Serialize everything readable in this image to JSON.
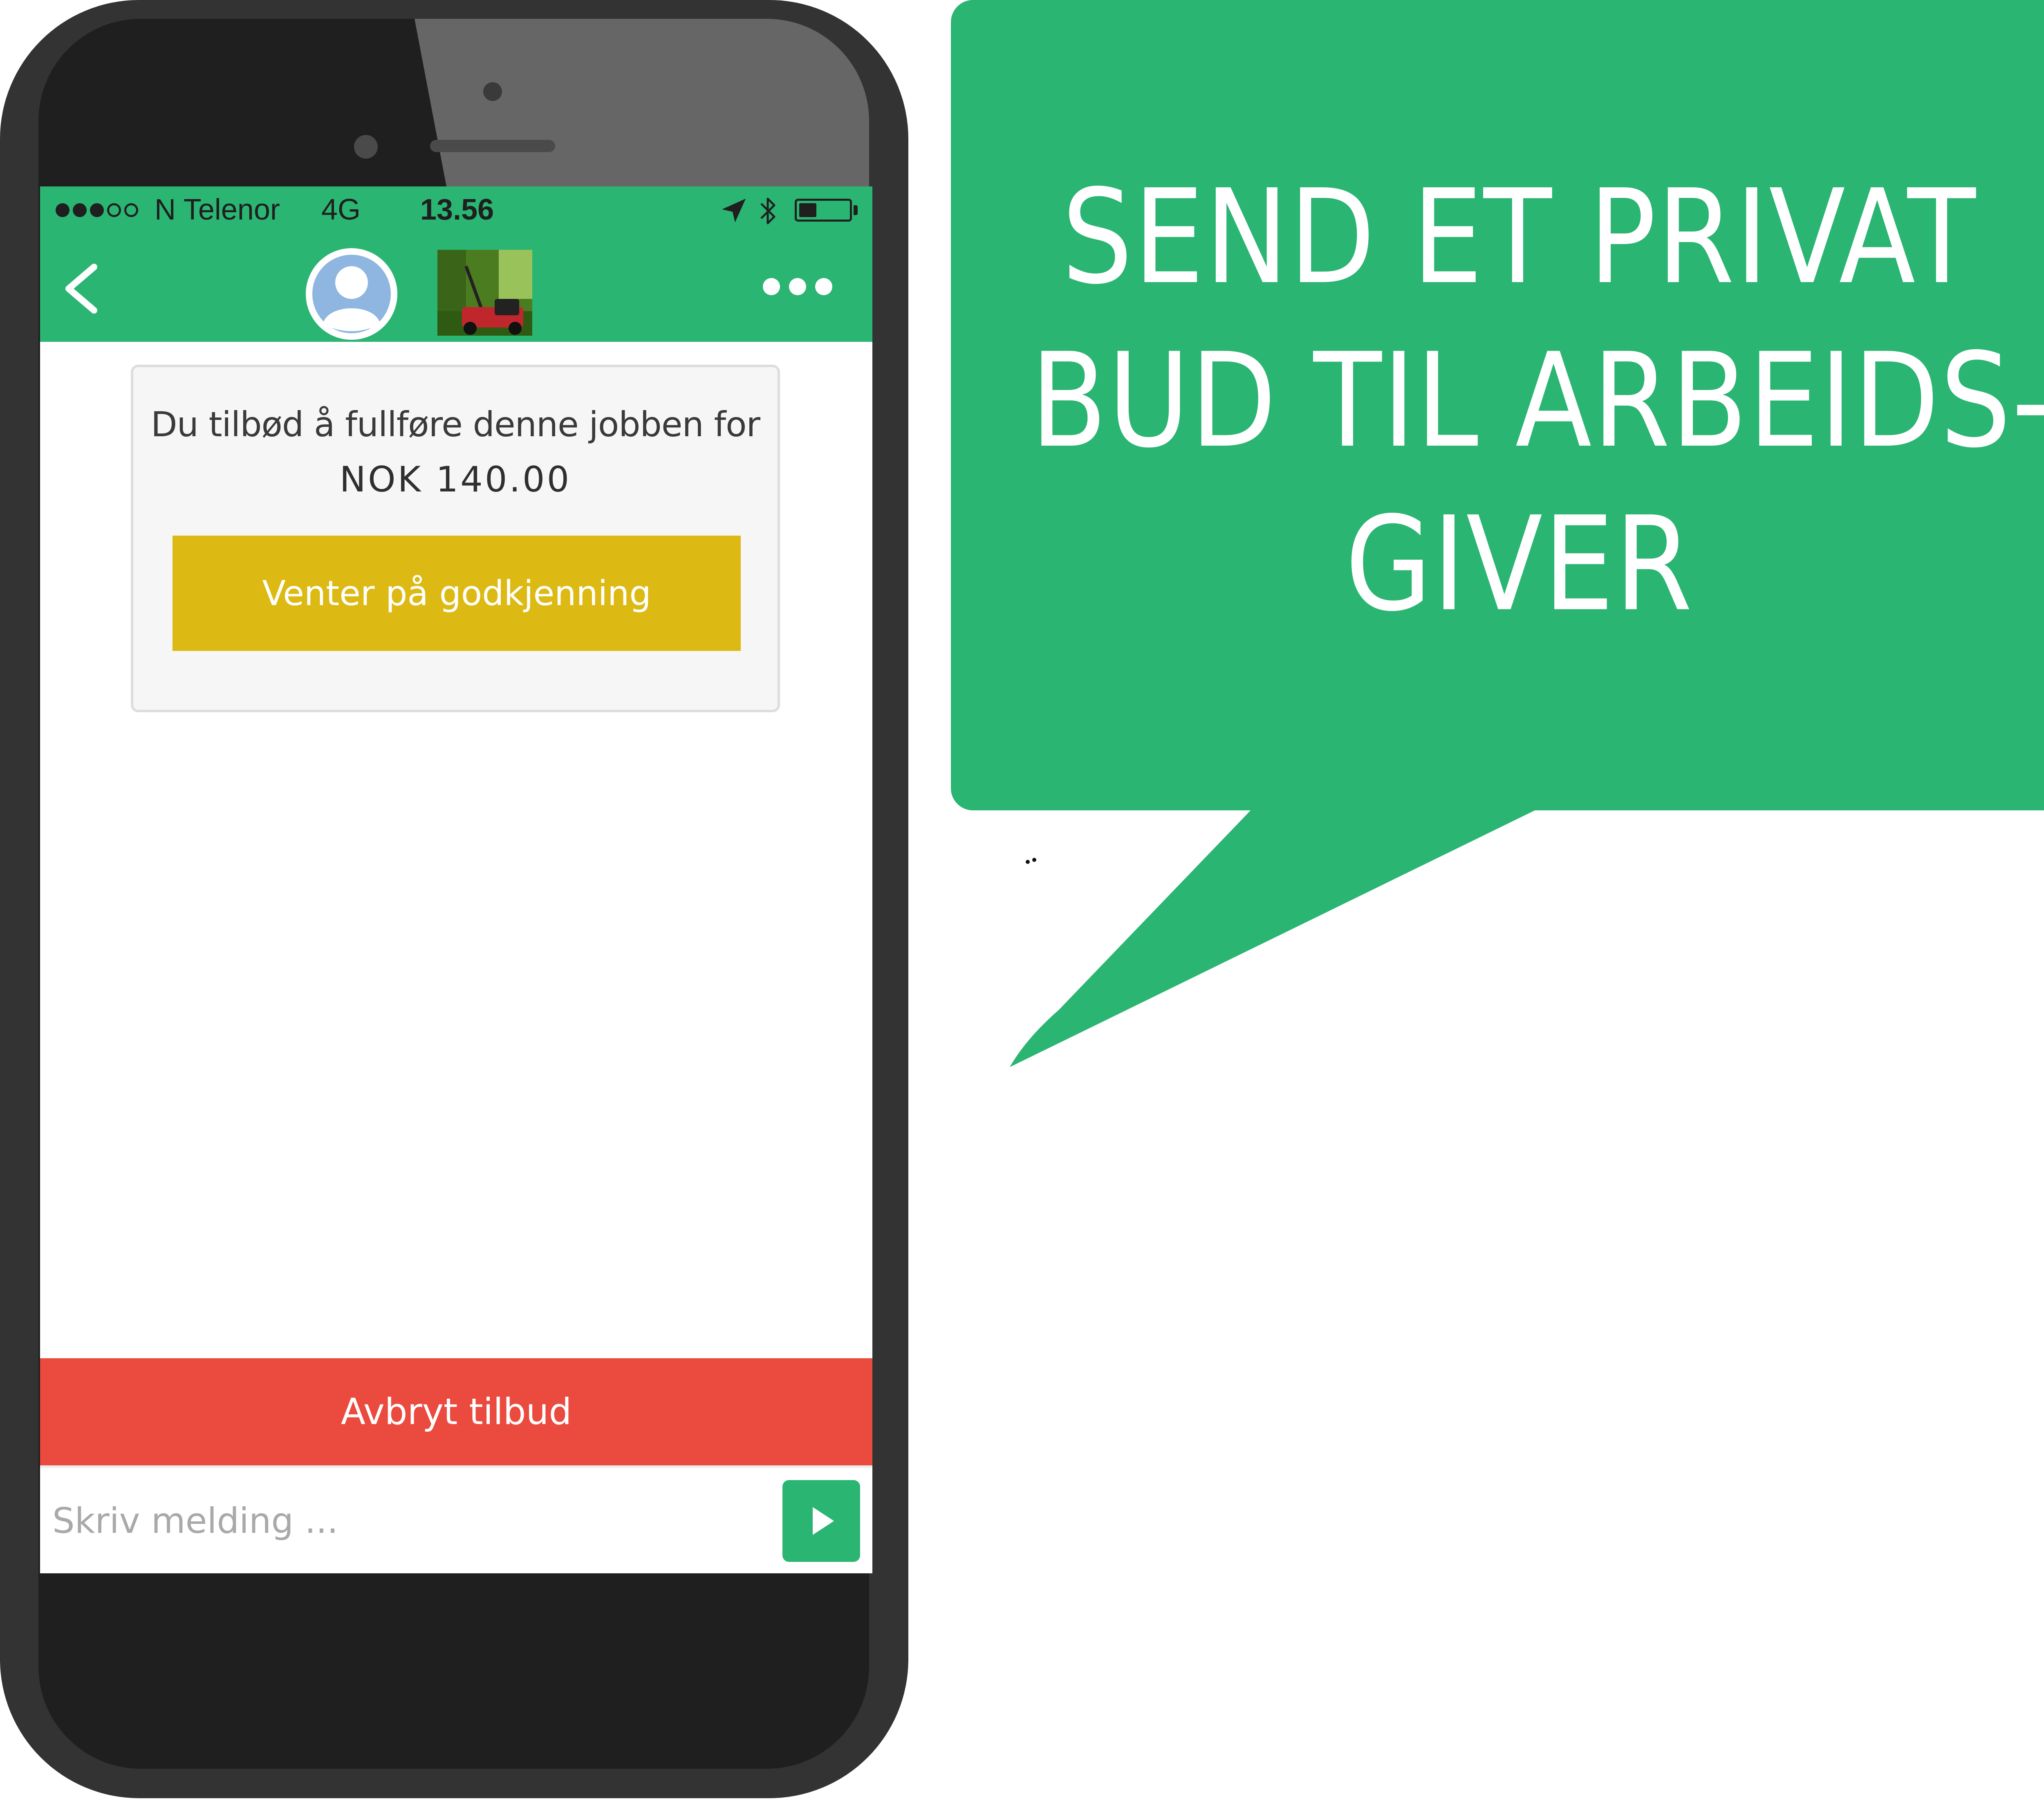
{
  "status_bar": {
    "signal_bars_filled": 3,
    "signal_bars_total": 5,
    "carrier": "N Telenor",
    "network": "4G",
    "time": "13.56",
    "battery_level": 0.35,
    "icons": [
      "location-arrow-icon",
      "bluetooth-icon",
      "battery-icon"
    ]
  },
  "nav": {
    "back_icon": "chevron-left-icon",
    "avatar_icon": "user-avatar-icon",
    "job_thumbnail": "lawn-mower-image",
    "more_icon": "more-dots-icon"
  },
  "offer": {
    "text": "Du tilbød å fullføre denne jobben for",
    "amount": "NOK 140.00",
    "status_button": "Venter på godkjenning"
  },
  "actions": {
    "cancel_label": "Avbryt tilbud"
  },
  "composer": {
    "placeholder": "Skriv melding ...",
    "value": "",
    "send_icon": "play-send-icon"
  },
  "callout": {
    "lines": [
      "SEND ET PRIVAT",
      "BUD TIL ARBEIDS-",
      "GIVER"
    ]
  },
  "colors": {
    "brand_green": "#2bb573",
    "pending_yellow": "#ddb914",
    "cancel_red": "#eb4a3e",
    "phone_frame": "#333333"
  }
}
